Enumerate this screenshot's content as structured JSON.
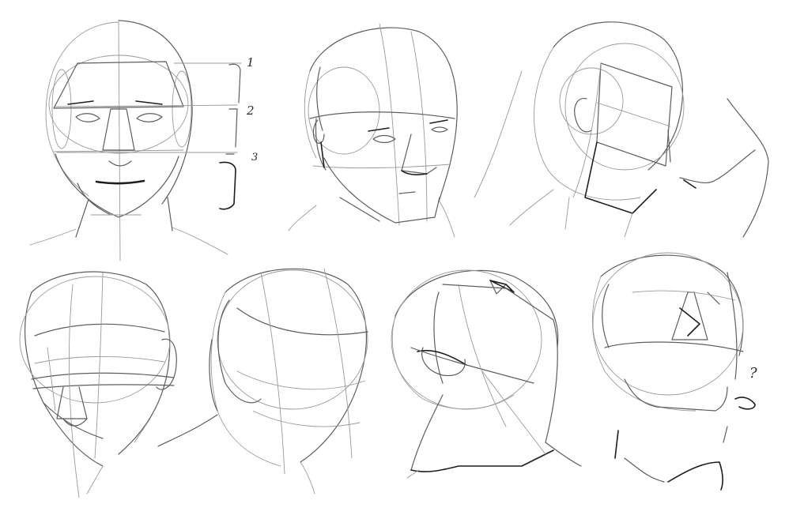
{
  "sheet": {
    "background_color": "#ffffff",
    "line_color": "#1e1e1e",
    "construction_line_color": "#9a9a9a"
  },
  "annotations": {
    "proportion_1": "1",
    "proportion_2": "2",
    "proportion_3": "3",
    "question_mark": "?"
  }
}
